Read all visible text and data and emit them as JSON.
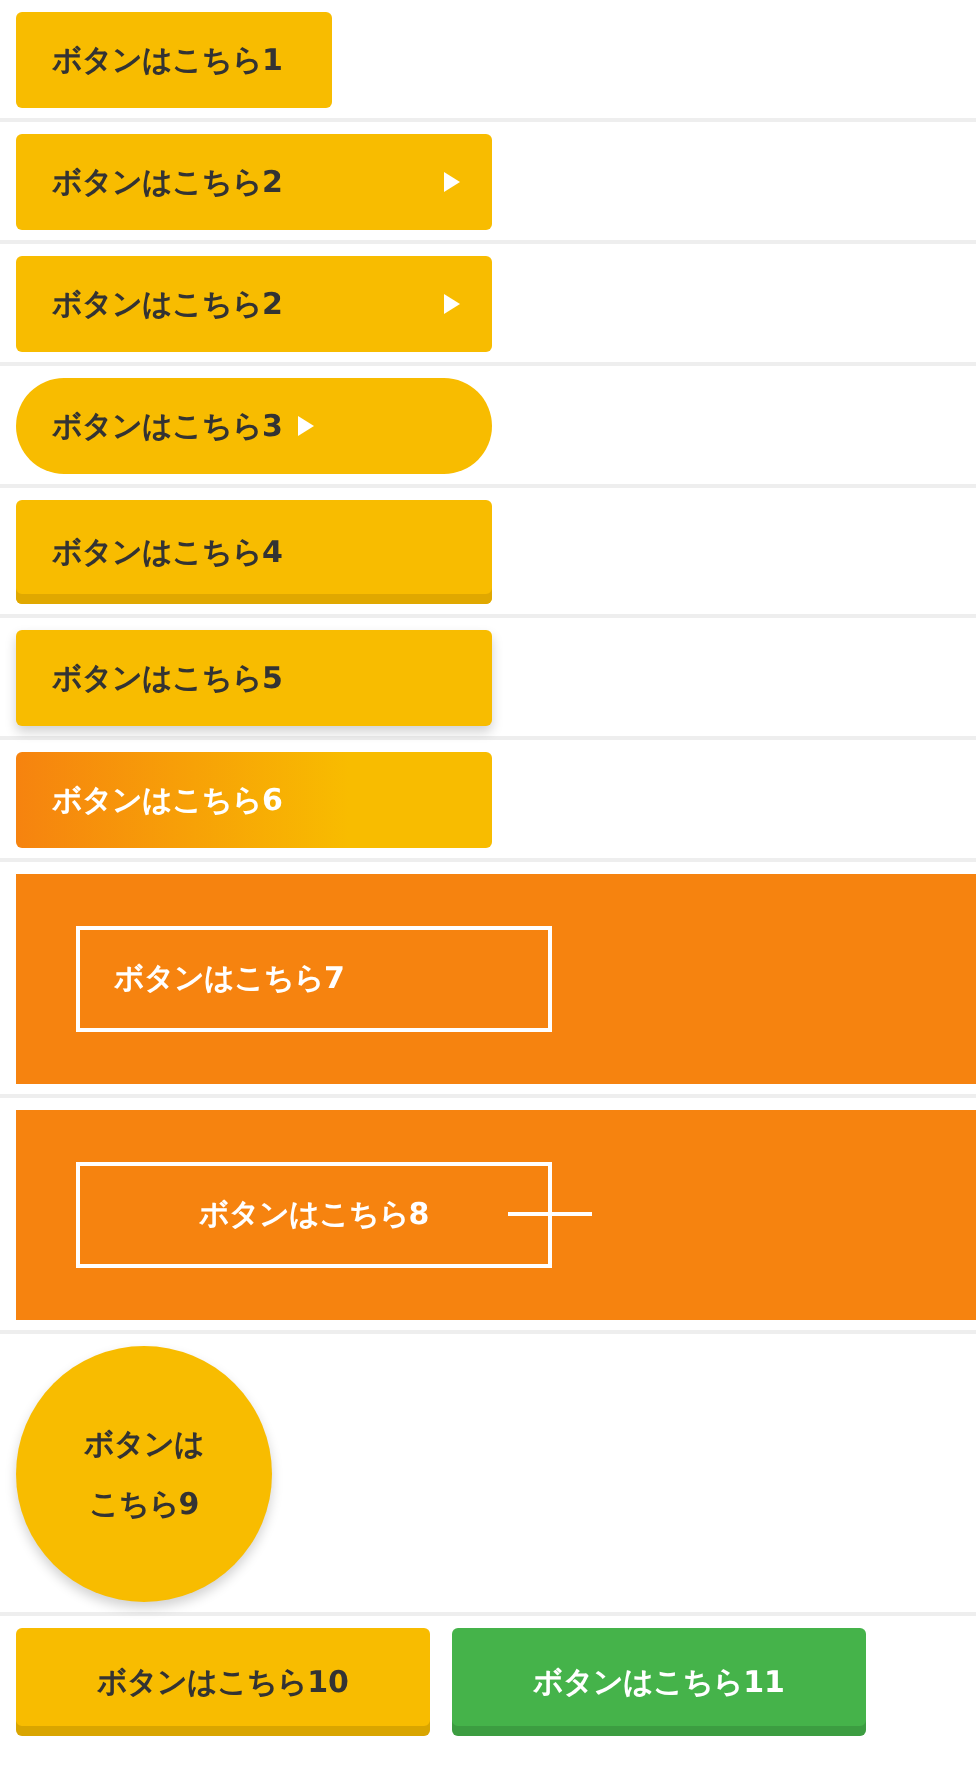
{
  "rows": [
    {
      "kind": "plain",
      "label": "ボタンはこちら1"
    },
    {
      "kind": "arrow",
      "label": "ボタンはこちら2"
    },
    {
      "kind": "arrow",
      "label": "ボタンはこちら2"
    },
    {
      "kind": "pill",
      "label": "ボタンはこちら3"
    },
    {
      "kind": "bottom-border",
      "label": "ボタンはこちら4"
    },
    {
      "kind": "shadow",
      "label": "ボタンはこちら5"
    },
    {
      "kind": "gradient",
      "label": "ボタンはこちら6"
    },
    {
      "kind": "outline-panel",
      "label": "ボタンはこちら7"
    },
    {
      "kind": "outline-line-panel",
      "label": "ボタンはこちら8"
    },
    {
      "kind": "circle",
      "label": "ボタンはこちら9"
    },
    {
      "kind": "pair",
      "buttons": [
        {
          "label": "ボタンはこちら10",
          "color": "#f8bc00"
        },
        {
          "label": "ボタンはこちら11",
          "color": "#45b34a"
        }
      ]
    }
  ]
}
